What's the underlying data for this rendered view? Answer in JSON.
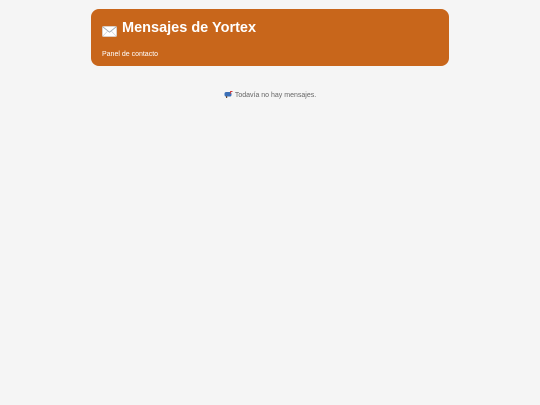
{
  "header": {
    "icon": "envelope-icon",
    "title": "Mensajes de Yortex",
    "subtitle": "Panel de contacto",
    "background_color": "#c8661b",
    "text_color": "#ffffff"
  },
  "messages": {
    "empty_icon": "mailbox-icon",
    "empty_text": "Todavía no hay mensajes.",
    "items": []
  },
  "page": {
    "background_color": "#f5f5f5"
  }
}
